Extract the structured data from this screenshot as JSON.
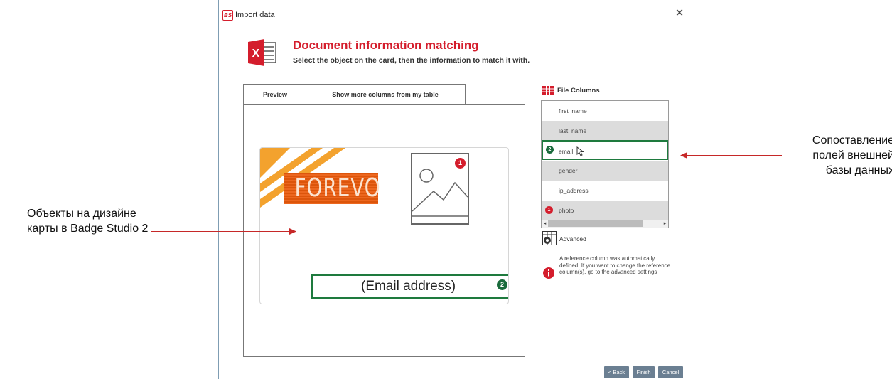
{
  "window": {
    "app_logo": "BS",
    "title": "Import data",
    "close_glyph": "✕"
  },
  "header": {
    "title": "Document information matching",
    "subtitle": "Select the object on the card, then the information to match it with.",
    "excel_icon_letter": "X"
  },
  "tabs": [
    {
      "label": "Preview",
      "active": true
    },
    {
      "label": "Show more columns from my table",
      "active": false
    }
  ],
  "card": {
    "logo_text": "FOREVO",
    "email_placeholder": "(Email address)",
    "photo_badge": "1",
    "email_badge": "2"
  },
  "file_columns": {
    "title": "File Columns",
    "items": [
      {
        "label": "first_name",
        "badge": ""
      },
      {
        "label": "last_name",
        "badge": ""
      },
      {
        "label": "email",
        "badge": "2"
      },
      {
        "label": "gender",
        "badge": ""
      },
      {
        "label": "ip_address",
        "badge": ""
      },
      {
        "label": "photo",
        "badge": "1"
      }
    ]
  },
  "advanced": {
    "label": "Advanced"
  },
  "info": {
    "text": "A reference column was automatically defined. If you want to change the reference column(s), go to the advanced settings"
  },
  "buttons": {
    "back": "< Back",
    "finish": "Finish",
    "cancel": "Cancel"
  },
  "annotations": {
    "left_bold": "Объекты на дизайне карты в",
    "left_normal": "Badge Studio 2",
    "right": "Сопоставление полей внешней базы данных"
  },
  "colors": {
    "accent_red": "#d41d2c",
    "match_green": "#1e7a3e",
    "button": "#6b7f92",
    "brand_orange": "#ea5a0c"
  }
}
